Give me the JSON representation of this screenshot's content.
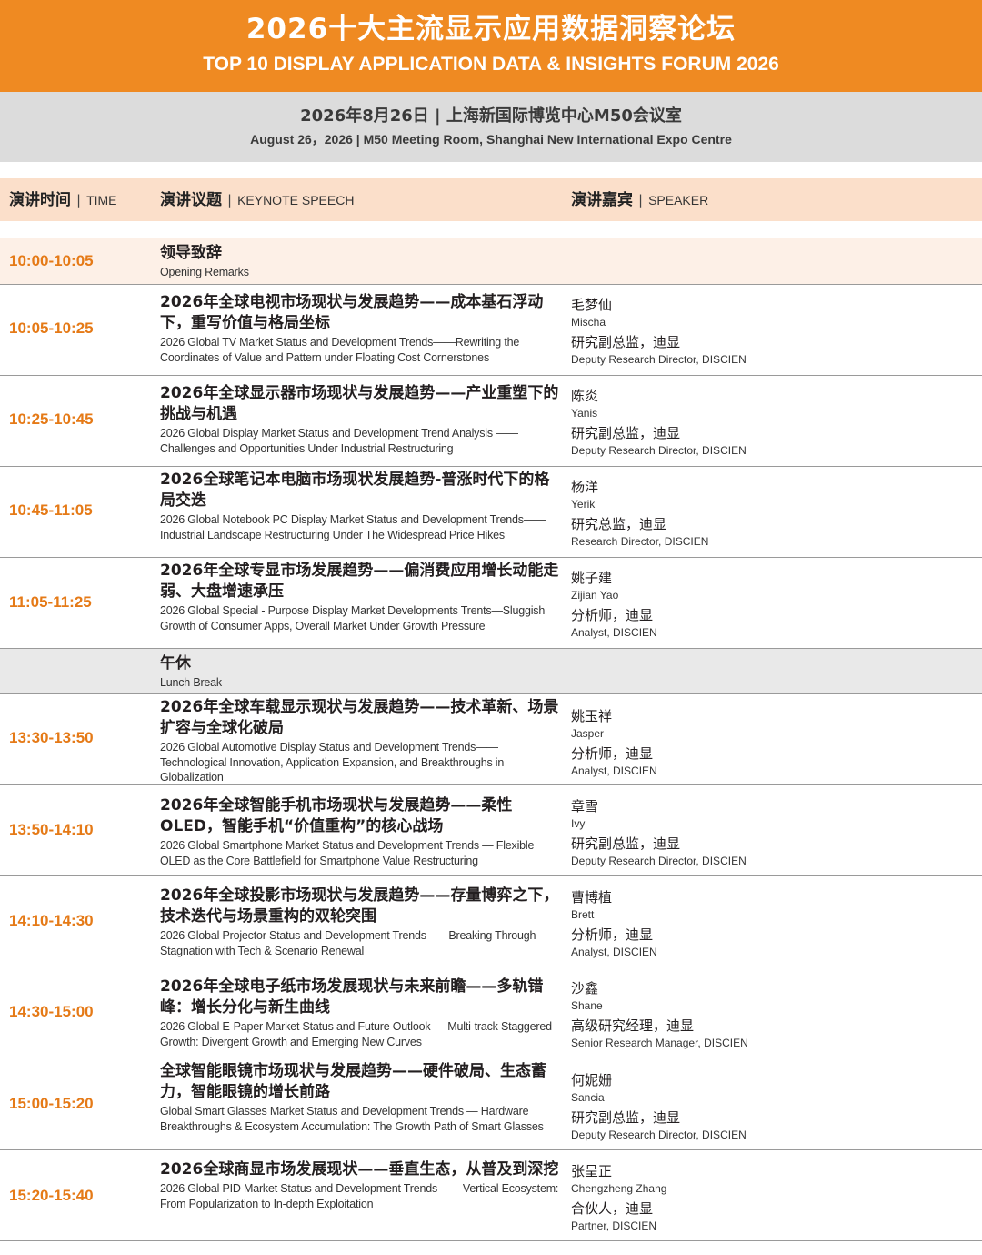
{
  "header": {
    "title_cn": "2026十大主流显示应用数据洞察论坛",
    "title_en": "TOP 10 DISPLAY APPLICATION DATA & INSIGHTS FORUM 2026",
    "colors": {
      "orange": "#ef8a22",
      "time_orange": "#e57a17",
      "gray_band": "#dcdcdc",
      "peach": "#fbdfca"
    }
  },
  "event": {
    "date_venue_cn": "2026年8月26日 | 上海新国际博览中心M50会议室",
    "date_venue_en": "August 26，2026  |  M50 Meeting Room, Shanghai New International Expo Centre"
  },
  "table_header": {
    "time_cn": "演讲时间",
    "time_en": "TIME",
    "topic_cn": "演讲议题",
    "topic_en": "KEYNOTE SPEECH",
    "speaker_cn": "演讲嘉宾",
    "speaker_en": "SPEAKER",
    "separator": "|"
  },
  "rows": [
    {
      "time": "10:00-10:05",
      "topic_cn": "领导致辞",
      "topic_en": "Opening Remarks"
    },
    {
      "time": "10:05-10:25",
      "topic_cn": "2026年全球电视市场现状与发展趋势——成本基石浮动下，重写价值与格局坐标",
      "topic_en": "2026 Global TV Market Status and Development Trends——Rewriting the Coordinates of Value and Pattern under Floating Cost Cornerstones",
      "speaker_cn": "毛梦仙",
      "speaker_en": "Mischa",
      "title_cn": "研究副总监，迪显",
      "title_en": "Deputy Research Director, DISCIEN"
    },
    {
      "time": "10:25-10:45",
      "topic_cn": "2026年全球显示器市场现状与发展趋势——产业重塑下的挑战与机遇",
      "topic_en": "2026 Global Display Market Status and Development Trend Analysis —— Challenges and Opportunities Under Industrial Restructuring",
      "speaker_cn": "陈炎",
      "speaker_en": "Yanis",
      "title_cn": "研究副总监，迪显",
      "title_en": "Deputy Research Director, DISCIEN"
    },
    {
      "time": "10:45-11:05",
      "topic_cn": "2026全球笔记本电脑市场现状发展趋势-普涨时代下的格局交迭",
      "topic_en": "2026 Global Notebook PC Display Market Status and Development Trends—— Industrial Landscape Restructuring Under The Widespread Price Hikes",
      "speaker_cn": "杨洋",
      "speaker_en": "Yerik",
      "title_cn": "研究总监，迪显",
      "title_en": "Research Director, DISCIEN"
    },
    {
      "time": "11:05-11:25",
      "topic_cn": "2026年全球专显市场发展趋势——偏消费应用增长动能走弱、大盘增速承压",
      "topic_en": "2026 Global Special - Purpose Display Market Developments Trents—Sluggish Growth of Consumer Apps, Overall Market Under Growth Pressure",
      "speaker_cn": "姚子建",
      "speaker_en": "Zijian Yao",
      "title_cn": "分析师，迪显",
      "title_en": "Analyst, DISCIEN"
    },
    {
      "time": "",
      "topic_cn": "午休",
      "topic_en": "Lunch Break"
    },
    {
      "time": "13:30-13:50",
      "topic_cn": "2026年全球车载显示现状与发展趋势——技术革新、场景扩容与全球化破局",
      "topic_en": "2026 Global Automotive Display Status and Development Trends——Technological Innovation, Application Expansion, and Breakthroughs in Globalization",
      "speaker_cn": "姚玉祥",
      "speaker_en": "Jasper",
      "title_cn": "分析师，迪显",
      "title_en": "Analyst, DISCIEN"
    },
    {
      "time": "13:50-14:10",
      "topic_cn": "2026年全球智能手机市场现状与发展趋势——柔性OLED，智能手机“价值重构”的核心战场",
      "topic_en": "2026 Global Smartphone Market Status and Development Trends — Flexible OLED as the Core Battlefield for Smartphone Value Restructuring",
      "speaker_cn": "章雪",
      "speaker_en": "Ivy",
      "title_cn": "研究副总监，迪显",
      "title_en": "Deputy Research Director, DISCIEN"
    },
    {
      "time": "14:10-14:30",
      "topic_cn": "2026年全球投影市场现状与发展趋势——存量博弈之下，技术迭代与场景重构的双轮突围",
      "topic_en": "2026 Global Projector Status and Development Trends——Breaking Through Stagnation with Tech & Scenario Renewal",
      "speaker_cn": "曹博植",
      "speaker_en": "Brett",
      "title_cn": "分析师，迪显",
      "title_en": "Analyst, DISCIEN"
    },
    {
      "time": "14:30-15:00",
      "topic_cn": "2026年全球电子纸市场发展现状与未来前瞻——多轨错峰：增长分化与新生曲线",
      "topic_en": "2026 Global E-Paper Market Status and Future Outlook — Multi-track Staggered Growth: Divergent Growth and Emerging New Curves",
      "speaker_cn": "沙鑫",
      "speaker_en": "Shane",
      "title_cn": "高级研究经理，迪显",
      "title_en": "Senior Research Manager, DISCIEN"
    },
    {
      "time": "15:00-15:20",
      "topic_cn": "全球智能眼镜市场现状与发展趋势——硬件破局、生态蓄力，智能眼镜的增长前路",
      "topic_en": "Global Smart Glasses Market Status and Development Trends — Hardware Breakthroughs & Ecosystem Accumulation: The Growth Path of Smart Glasses",
      "speaker_cn": "何妮姗",
      "speaker_en": "Sancia",
      "title_cn": "研究副总监，迪显",
      "title_en": "Deputy Research Director, DISCIEN"
    },
    {
      "time": "15:20-15:40",
      "topic_cn": "2026全球商显市场发展现状——垂直生态，从普及到深挖",
      "topic_en": "2026 Global PID Market Status and Development Trends—— Vertical Ecosystem: From Popularization to In-depth Exploitation",
      "speaker_cn": "张呈正",
      "speaker_en": "Chengzheng Zhang",
      "title_cn": "合伙人，迪显",
      "title_en": "Partner, DISCIEN"
    }
  ]
}
